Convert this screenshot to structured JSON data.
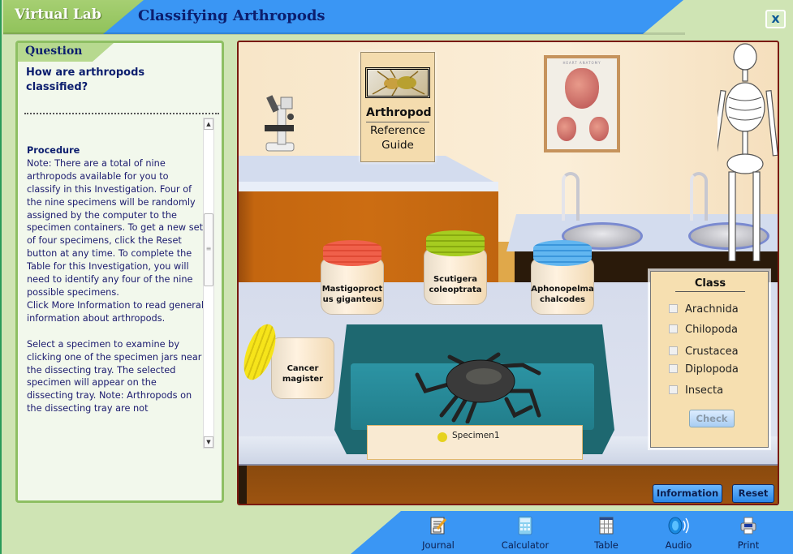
{
  "header": {
    "app_name": "Virtual Lab",
    "title": "Classifying Arthropods",
    "close_label": "x"
  },
  "question_panel": {
    "tab_label": "Question",
    "question": "How are arthropods classified?",
    "procedure_heading": "Procedure",
    "paragraphs": [
      "Note: There are a total of nine arthropods available for you to classify in this Investigation. Four of the nine specimens will be randomly assigned by the computer to the specimen containers. To get a new set of four specimens, click the Reset button at any time. To complete the Table for this Investigation, you will need to identify any four of the nine possible specimens.",
      "Click More Information to read general information about arthropods.",
      "Select a specimen to examine by clicking one of the specimen jars near the dissecting tray. The selected specimen will appear on the dissecting tray. Note: Arthropods on the dissecting tray are not"
    ]
  },
  "lab": {
    "reference_guide": {
      "title": "Arthropod",
      "subtitle": "Reference Guide"
    },
    "poster_title": "HEART ANATOMY",
    "jars": [
      {
        "label": "Mastigoproctus giganteus",
        "label_display": "Mastigoproct us giganteus",
        "lid_color": "#f0604a",
        "state": "closed"
      },
      {
        "label": "Scutigera coleoptrata",
        "label_display": "Scutigera coleoptrata",
        "lid_color": "#9ac21a",
        "state": "closed"
      },
      {
        "label": "Aphonopelma chalcodes",
        "label_display": "Aphonopelma chalcodes",
        "lid_color": "#5ab0ee",
        "state": "closed"
      },
      {
        "label": "Cancer magister",
        "label_display": "Cancer magister",
        "lid_color": "#f2e010",
        "state": "open"
      }
    ],
    "tray": {
      "specimen_label": "Specimen1",
      "specimen_dot_color": "#e6d21e"
    },
    "class_panel": {
      "title": "Class",
      "options": [
        {
          "label": "Arachnida",
          "checked": false
        },
        {
          "label": "Chilopoda",
          "checked": false
        },
        {
          "label": "Crustacea",
          "checked": false
        },
        {
          "label": "Diplopoda",
          "checked": false
        },
        {
          "label": "Insecta",
          "checked": false
        }
      ],
      "check_label": "Check"
    },
    "information_label": "Information",
    "reset_label": "Reset"
  },
  "toolbar": {
    "items": [
      {
        "label": "Journal",
        "icon": "journal-icon"
      },
      {
        "label": "Calculator",
        "icon": "calculator-icon"
      },
      {
        "label": "Table",
        "icon": "table-icon"
      },
      {
        "label": "Audio",
        "icon": "audio-icon"
      },
      {
        "label": "Print",
        "icon": "print-icon"
      }
    ]
  }
}
